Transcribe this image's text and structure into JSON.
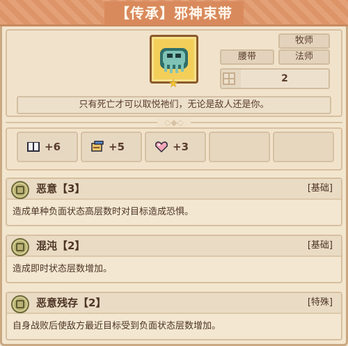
{
  "title": "【传承】邪神束带",
  "item": {
    "icon": "belt-skull-icon",
    "rarity_icon": "star-icon",
    "class_tags": [
      "牧师",
      "法师"
    ],
    "category": "腰带",
    "slot_count": "2",
    "flavor_text": "只有死亡才可以取悦祂们，无论是敌人还是你。"
  },
  "stats": [
    {
      "icon": "book-icon",
      "value": "+6"
    },
    {
      "icon": "scroll-icon",
      "value": "+5"
    },
    {
      "icon": "heart-icon",
      "value": "+3"
    }
  ],
  "skills": [
    {
      "name": "恶意【3】",
      "type": "[基础]",
      "description": "造成单种负面状态高层数时对目标造成恐惧。"
    },
    {
      "name": "混沌【2】",
      "type": "[基础]",
      "description": "造成即时状态层数增加。"
    },
    {
      "name": "恶意残存【2】",
      "type": "[特殊]",
      "description": "自身战败后使敌方最近目标受到负面状态层数增加。"
    }
  ],
  "colors": {
    "title_bar": "#dd9a6c",
    "panel": "#f1e3cb",
    "item_frame": "#f3cf5a",
    "text": "#5a3d2b"
  }
}
